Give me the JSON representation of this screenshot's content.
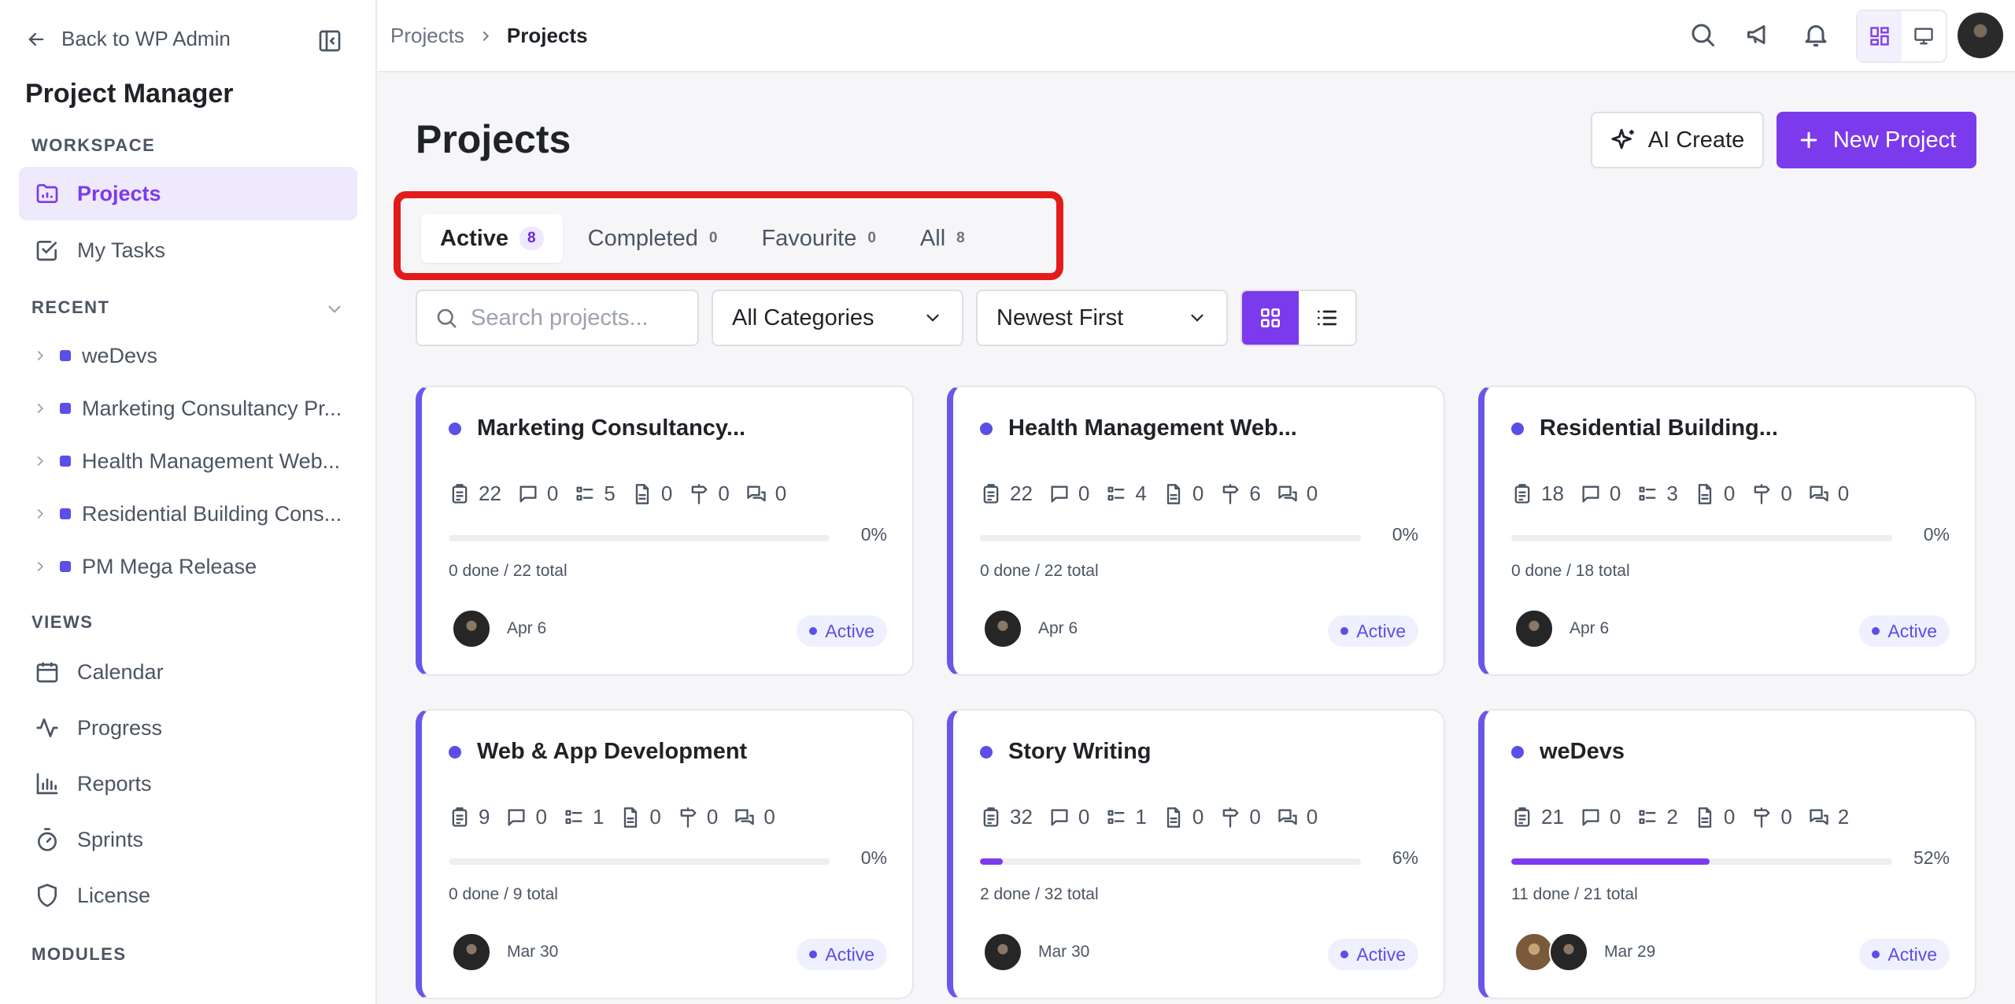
{
  "sidebar": {
    "back_label": "Back to WP Admin",
    "app_title": "Project Manager",
    "workspace_label": "WORKSPACE",
    "workspace_items": [
      {
        "label": "Projects",
        "icon": "folder-icon"
      },
      {
        "label": "My Tasks",
        "icon": "check-square-icon"
      }
    ],
    "recent_label": "RECENT",
    "recent_items": [
      {
        "label": "weDevs"
      },
      {
        "label": "Marketing Consultancy Pr..."
      },
      {
        "label": "Health Management Web..."
      },
      {
        "label": "Residential Building Cons..."
      },
      {
        "label": "PM Mega Release"
      }
    ],
    "views_label": "VIEWS",
    "view_items": [
      {
        "label": "Calendar",
        "icon": "calendar-icon"
      },
      {
        "label": "Progress",
        "icon": "activity-icon"
      },
      {
        "label": "Reports",
        "icon": "bar-chart-icon"
      },
      {
        "label": "Sprints",
        "icon": "timer-icon"
      },
      {
        "label": "License",
        "icon": "shield-icon"
      }
    ],
    "modules_label": "MODULES"
  },
  "header": {
    "breadcrumb": [
      "Projects",
      "Projects"
    ]
  },
  "main": {
    "title": "Projects",
    "ai_create_label": "AI Create",
    "new_project_label": "New Project",
    "tabs": [
      {
        "label": "Active",
        "count": "8"
      },
      {
        "label": "Completed",
        "count": "0"
      },
      {
        "label": "Favourite",
        "count": "0"
      },
      {
        "label": "All",
        "count": "8"
      }
    ],
    "search_placeholder": "Search projects...",
    "category_select": "All Categories",
    "sort_select": "Newest First"
  },
  "projects": [
    {
      "name": "Marketing Consultancy...",
      "tasks": "22",
      "comments": "0",
      "lists": "5",
      "files": "0",
      "milestones": "0",
      "discussions": "0",
      "progress": 0,
      "progress_label": "0%",
      "done_label": "0 done / 22 total",
      "date": "Apr 6",
      "status": "Active",
      "avatars": 1
    },
    {
      "name": "Health Management Web...",
      "tasks": "22",
      "comments": "0",
      "lists": "4",
      "files": "0",
      "milestones": "6",
      "discussions": "0",
      "progress": 0,
      "progress_label": "0%",
      "done_label": "0 done / 22 total",
      "date": "Apr 6",
      "status": "Active",
      "avatars": 1
    },
    {
      "name": "Residential Building...",
      "tasks": "18",
      "comments": "0",
      "lists": "3",
      "files": "0",
      "milestones": "0",
      "discussions": "0",
      "progress": 0,
      "progress_label": "0%",
      "done_label": "0 done / 18 total",
      "date": "Apr 6",
      "status": "Active",
      "avatars": 1
    },
    {
      "name": "Web & App Development",
      "tasks": "9",
      "comments": "0",
      "lists": "1",
      "files": "0",
      "milestones": "0",
      "discussions": "0",
      "progress": 0,
      "progress_label": "0%",
      "done_label": "0 done / 9 total",
      "date": "Mar 30",
      "status": "Active",
      "avatars": 1
    },
    {
      "name": "Story Writing",
      "tasks": "32",
      "comments": "0",
      "lists": "1",
      "files": "0",
      "milestones": "0",
      "discussions": "0",
      "progress": 6,
      "progress_label": "6%",
      "done_label": "2 done / 32 total",
      "date": "Mar 30",
      "status": "Active",
      "avatars": 1
    },
    {
      "name": "weDevs",
      "tasks": "21",
      "comments": "0",
      "lists": "2",
      "files": "0",
      "milestones": "0",
      "discussions": "2",
      "progress": 52,
      "progress_label": "52%",
      "done_label": "11 done / 21 total",
      "date": "Mar 29",
      "status": "Active",
      "avatars": 2
    }
  ],
  "colors": {
    "accent": "#7c3aed",
    "project_dot": "#5a4fe6",
    "highlight": "#e31b1b"
  }
}
